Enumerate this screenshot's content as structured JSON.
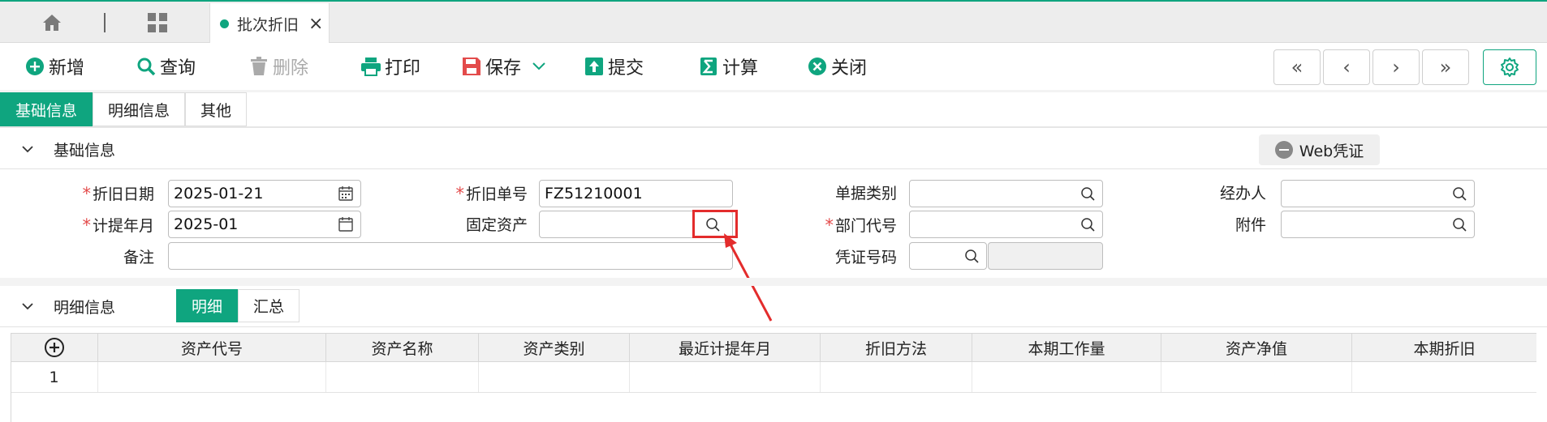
{
  "tabbar": {
    "active_tab": "批次折旧"
  },
  "toolbar": {
    "add": "新增",
    "query": "查询",
    "delete": "删除",
    "print": "打印",
    "save": "保存",
    "submit": "提交",
    "calc": "计算",
    "close": "关闭"
  },
  "page_tabs": [
    "基础信息",
    "明细信息",
    "其他"
  ],
  "basic_section": {
    "title": "基础信息",
    "web_voucher": "Web凭证"
  },
  "form": {
    "depr_date": {
      "label": "折旧日期",
      "value": "2025-01-21"
    },
    "depr_no": {
      "label": "折旧单号",
      "value": "FZ51210001"
    },
    "doc_type": {
      "label": "单据类别",
      "value": ""
    },
    "handler": {
      "label": "经办人",
      "value": ""
    },
    "accrual_month": {
      "label": "计提年月",
      "value": "2025-01"
    },
    "fixed_asset": {
      "label": "固定资产",
      "value": ""
    },
    "dept_code": {
      "label": "部门代号",
      "value": ""
    },
    "attachment": {
      "label": "附件",
      "value": ""
    },
    "remark": {
      "label": "备注",
      "value": ""
    },
    "voucher_no": {
      "label": "凭证号码",
      "value": ""
    }
  },
  "detail_section": {
    "title": "明细信息",
    "tabs": [
      "明细",
      "汇总"
    ]
  },
  "grid": {
    "columns": [
      "资产代号",
      "资产名称",
      "资产类别",
      "最近计提年月",
      "折旧方法",
      "本期工作量",
      "资产净值",
      "本期折旧"
    ],
    "rows": [
      {
        "index": "1"
      }
    ]
  },
  "colors": {
    "accent": "#0fa57f",
    "required": "#e34b4b",
    "highlight": "#e32c2c"
  }
}
